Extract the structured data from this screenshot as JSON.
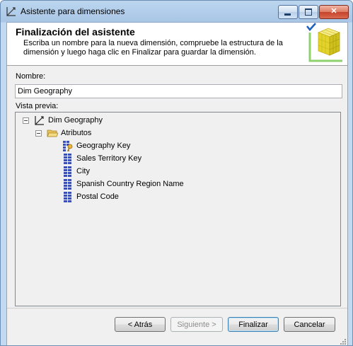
{
  "window": {
    "title": "Asistente para dimensiones",
    "icon": "dimension-icon",
    "controls": [
      "minimize-icon",
      "maximize-icon",
      "close-icon"
    ]
  },
  "header": {
    "title": "Finalización del asistente",
    "description": "Escriba un nombre para la nueva dimensión, compruebe la estructura de la dimensión y luego haga clic en Finalizar para guardar la dimensión.",
    "graphic": "cube-check-icon"
  },
  "name_field": {
    "label": "Nombre:",
    "value": "Dim Geography"
  },
  "preview": {
    "label": "Vista previa:",
    "root": "Dim Geography",
    "folder": "Atributos",
    "attributes": [
      {
        "label": "Geography Key",
        "icon": "key-attribute-icon"
      },
      {
        "label": "Sales Territory Key",
        "icon": "attribute-icon"
      },
      {
        "label": "City",
        "icon": "attribute-icon"
      },
      {
        "label": "Spanish Country Region Name",
        "icon": "attribute-icon"
      },
      {
        "label": "Postal Code",
        "icon": "attribute-icon"
      }
    ]
  },
  "buttons": {
    "back": "< Atrás",
    "next": "Siguiente >",
    "finish": "Finalizar",
    "cancel": "Cancelar"
  },
  "colors": {
    "titlebar": "#bcd6ef",
    "client": "#f0f0f0",
    "attribute_icon": "#3b4fb8",
    "folder": "#e8c15a",
    "check": "#1d5fbf",
    "cube": "#e2d42b"
  }
}
